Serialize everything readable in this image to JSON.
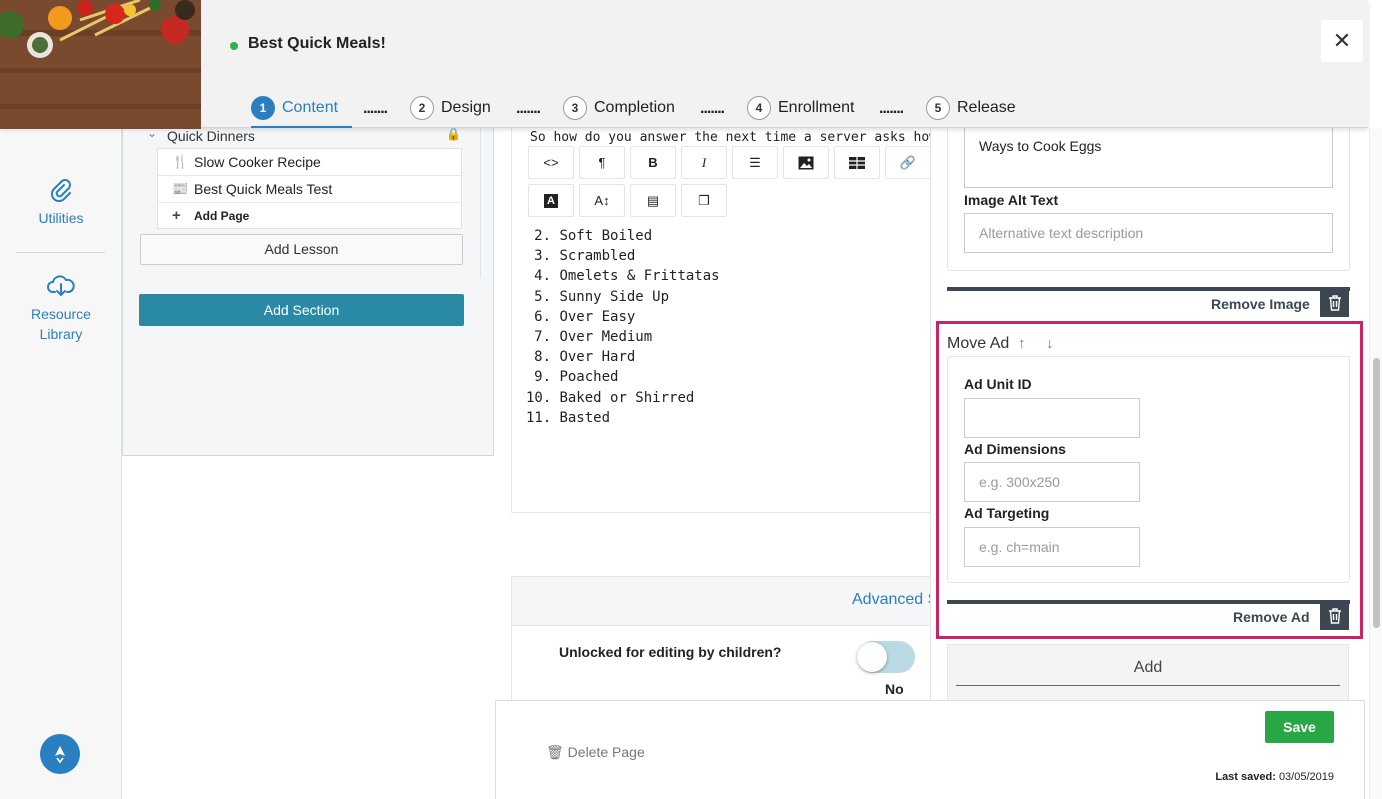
{
  "header": {
    "title": "Best Quick Meals!",
    "close_icon": "close-icon",
    "status_color": "#2cb34a",
    "steps": [
      {
        "num": "1",
        "label": "Content"
      },
      {
        "num": "2",
        "label": "Design"
      },
      {
        "num": "3",
        "label": "Completion"
      },
      {
        "num": "4",
        "label": "Enrollment"
      },
      {
        "num": "5",
        "label": "Release"
      }
    ],
    "separator": "......."
  },
  "rail": {
    "utilities": "Utilities",
    "resource_library": "Resource Library"
  },
  "outline": {
    "section_title": "Quick Dinners",
    "pages": [
      "Slow Cooker Recipe",
      "Best Quick Meals Test"
    ],
    "add_page": "Add Page",
    "add_lesson": "Add Lesson",
    "add_section": "Add Section"
  },
  "editor": {
    "intro": "So how do you answer the next time a server asks how you'd lik",
    "toolbar": [
      "code",
      "paragraph",
      "bold",
      "italic",
      "list",
      "image",
      "table",
      "link",
      "text-color",
      "font-size",
      "align",
      "copy"
    ],
    "list_items": [
      {
        "num": "2.",
        "text": "Soft Boiled"
      },
      {
        "num": "3.",
        "text": "Scrambled"
      },
      {
        "num": "4.",
        "text": "Omelets & Frittatas"
      },
      {
        "num": "5.",
        "text": "Sunny Side Up"
      },
      {
        "num": "6.",
        "text": "Over Easy"
      },
      {
        "num": "7.",
        "text": "Over Medium"
      },
      {
        "num": "8.",
        "text": "Over Hard"
      },
      {
        "num": "9.",
        "text": "Poached"
      },
      {
        "num": "10.",
        "text": "Baked or Shirred"
      },
      {
        "num": "11.",
        "text": "Basted"
      }
    ]
  },
  "advanced": {
    "title": "Advanced S",
    "question": "Unlocked for editing by children?",
    "toggle_state": "No"
  },
  "panel": {
    "image_caption_value": "Ways to Cook Eggs",
    "image_alt_label": "Image Alt Text",
    "image_alt_placeholder": "Alternative text description",
    "remove_image": "Remove Image",
    "move_ad": "Move Ad",
    "ad_unit_label": "Ad Unit ID",
    "ad_unit_value": "",
    "ad_dimensions_label": "Ad Dimensions",
    "ad_dimensions_placeholder": "e.g. 300x250",
    "ad_targeting_label": "Ad Targeting",
    "ad_targeting_placeholder": "e.g. ch=main",
    "remove_ad": "Remove Ad",
    "add": "Add",
    "highlight_color": "#c8246b"
  },
  "footer": {
    "delete_page": "Delete Page",
    "save": "Save",
    "last_saved_label": "Last saved:",
    "last_saved_date": "03/05/2019"
  }
}
